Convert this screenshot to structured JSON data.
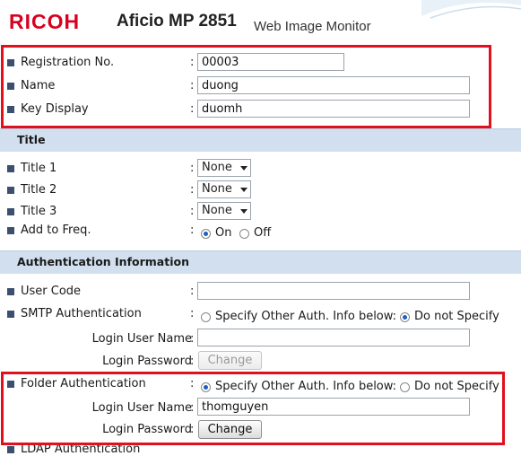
{
  "header": {
    "brand": "RICOH",
    "model": "Aficio MP 2851",
    "app_name": "Web Image Monitor"
  },
  "colon": ":",
  "fields": {
    "registration_no": {
      "label": "Registration No.",
      "value": "00003"
    },
    "name": {
      "label": "Name",
      "value": "duong"
    },
    "key_display": {
      "label": "Key Display",
      "value": "duomh"
    }
  },
  "title_section": {
    "heading": "Title",
    "title1": {
      "label": "Title 1",
      "value": "None"
    },
    "title2": {
      "label": "Title 2",
      "value": "None"
    },
    "title3": {
      "label": "Title 3",
      "value": "None"
    },
    "add_to_freq": {
      "label": "Add to Freq.",
      "on": "On",
      "off": "Off",
      "selected": "On"
    }
  },
  "auth_section": {
    "heading": "Authentication Information",
    "user_code": {
      "label": "User Code",
      "value": ""
    },
    "smtp": {
      "label": "SMTP Authentication",
      "opt_specify": "Specify Other Auth. Info below:",
      "opt_donot": "Do not Specify",
      "selected": "Do not Specify",
      "login_user_label": "Login User Name",
      "login_user_value": "",
      "login_password_label": "Login Password",
      "change_label": "Change"
    },
    "folder": {
      "label": "Folder Authentication",
      "opt_specify": "Specify Other Auth. Info below:",
      "opt_donot": "Do not Specify",
      "selected": "Specify Other Auth. Info below:",
      "login_user_label": "Login User Name",
      "login_user_value": "thomguyen",
      "login_password_label": "Login Password",
      "change_label": "Change"
    },
    "ldap": {
      "label": "LDAP Authentication"
    }
  },
  "colors": {
    "brand_red": "#d8001f",
    "section_bg": "#d1dfee",
    "highlight_red": "#e0101e",
    "bullet": "#3d4f6e"
  }
}
